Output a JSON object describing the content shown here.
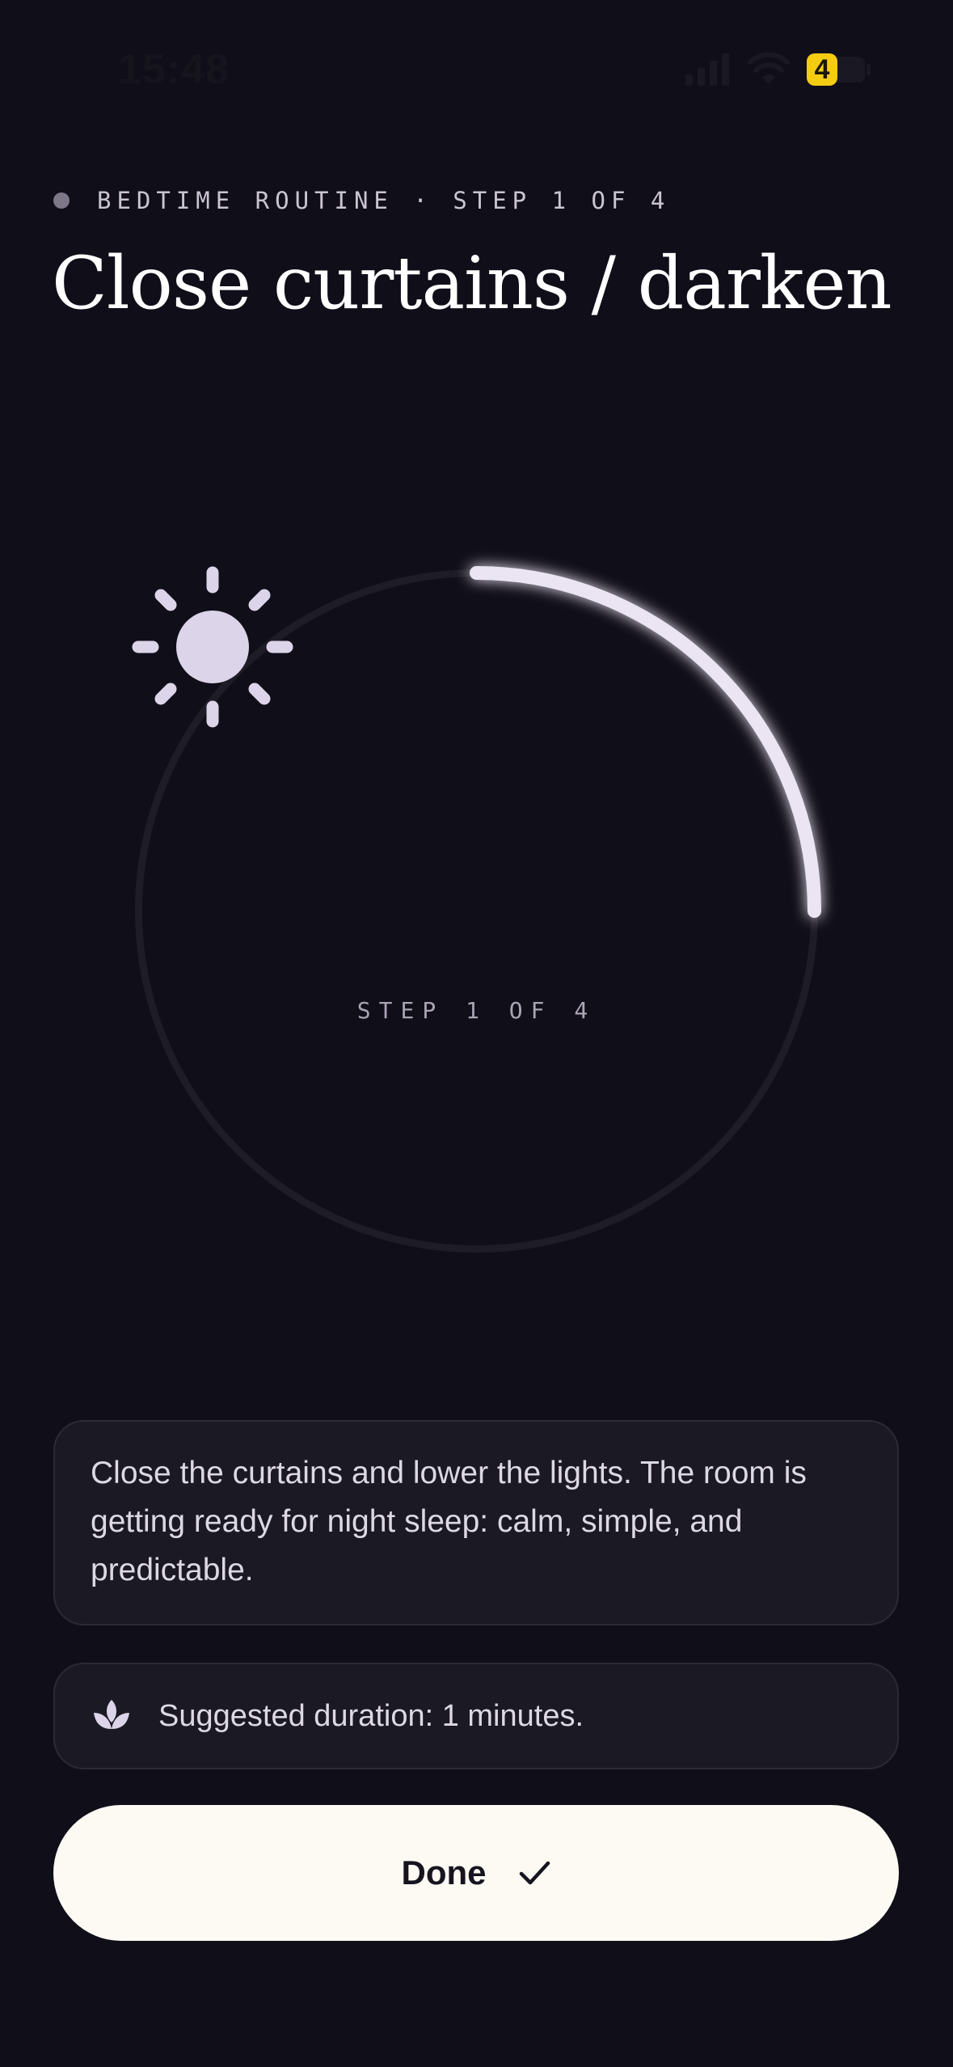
{
  "status_bar": {
    "time": "15:48",
    "battery_level": "4"
  },
  "header": {
    "eyebrow": "BEDTIME ROUTINE · STEP 1 OF 4",
    "title": "Close curtains / darken"
  },
  "progress": {
    "icon": "sun-icon",
    "caption": "STEP 1 OF 4",
    "fraction": 0.25
  },
  "description": {
    "text": "Close the curtains and lower the lights. The room is getting ready for night sleep: calm, simple, and predictable."
  },
  "duration": {
    "icon": "lotus-icon",
    "text": "Suggested duration: 1 minutes."
  },
  "done_button": {
    "label": "Done",
    "icon": "check-icon"
  },
  "colors": {
    "background": "#100e19",
    "card": "#1b1924",
    "card_border": "#2c2a35",
    "accent": "#e9e2f2",
    "button": "#fcfaf3",
    "battery_badge": "#f4cc12"
  }
}
